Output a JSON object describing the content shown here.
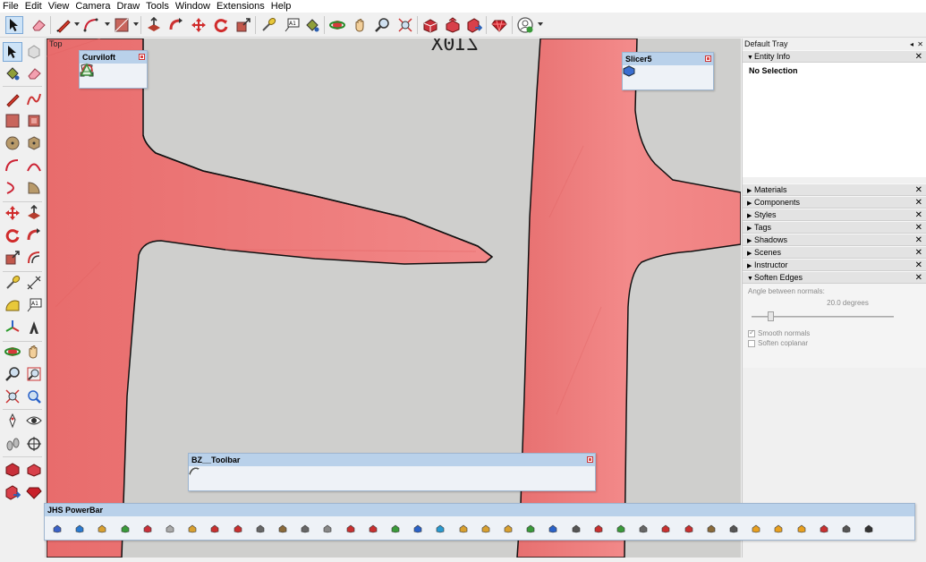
{
  "menu": [
    "File",
    "Edit",
    "View",
    "Camera",
    "Draw",
    "Tools",
    "Window",
    "Extensions",
    "Help"
  ],
  "viewport": {
    "scene_label": "Top",
    "watermark_text": "Z10X"
  },
  "floating_toolbars": {
    "curviloft": {
      "title": "Curviloft"
    },
    "slicer5": {
      "title": "Slicer5"
    },
    "bz_toolbar": {
      "title": "BZ__Toolbar"
    },
    "powerbar": {
      "title": "JHS PowerBar"
    }
  },
  "tray": {
    "title": "Default Tray",
    "entity_info": {
      "title": "Entity Info",
      "body": "No Selection"
    },
    "panels": [
      "Materials",
      "Components",
      "Styles",
      "Tags",
      "Shadows",
      "Scenes",
      "Instructor"
    ],
    "soften_edges": {
      "title": "Soften Edges",
      "angle_label": "Angle between normals:",
      "angle_value": "20.0  degrees",
      "angle_fraction": 0.12,
      "smooth_normals": {
        "label": "Smooth normals",
        "checked": true
      },
      "soften_coplanar": {
        "label": "Soften coplanar",
        "checked": false
      }
    }
  },
  "colors": {
    "model_face": "#f08080",
    "model_face_dark": "#e46e6e",
    "background": "#cfcfcd",
    "edge": "#111111",
    "title_bar": "#b9d1ea",
    "selection": "#cde3f7"
  },
  "icons": {
    "top_toolbar": [
      "select-arrow-icon",
      "eraser-icon",
      "pencil-line-icon",
      "arc-icon",
      "rectangle-icon",
      "push-pull-icon",
      "follow-me-icon",
      "move-icon",
      "rotate-icon",
      "scale-icon",
      "tape-measure-icon",
      "text-icon",
      "paint-bucket-icon",
      "orbit-icon",
      "pan-hand-icon",
      "zoom-icon",
      "zoom-extents-icon",
      "warehouse-icon",
      "extension-warehouse-icon",
      "share-model-icon",
      "ruby-console-icon",
      "profile-icon"
    ],
    "left_toolbar": [
      "select-arrow-icon",
      "lasso-select-icon",
      "paint-bucket-icon",
      "eraser-icon",
      "line-icon",
      "freehand-icon",
      "rectangle-icon",
      "rotated-rectangle-icon",
      "circle-icon",
      "polygon-icon",
      "arc-icon",
      "two-point-arc-icon",
      "three-point-arc-icon",
      "pie-icon",
      "move-icon",
      "push-pull-icon",
      "rotate-icon",
      "follow-me-icon",
      "scale-icon",
      "offset-icon",
      "tape-measure-icon",
      "dimension-icon",
      "protractor-icon",
      "text-icon",
      "axes-icon",
      "3d-text-icon",
      "orbit-icon",
      "pan-hand-icon",
      "zoom-icon",
      "zoom-window-icon",
      "zoom-extents-icon",
      "previous-view-icon",
      "position-camera-icon",
      "look-around-icon",
      "walk-icon",
      "section-plane-icon",
      "warehouse-icon",
      "extension-warehouse-icon",
      "share-model-icon",
      "ruby-icon"
    ],
    "curviloft": [
      "loft-by-spline-icon",
      "skin-contours-icon",
      "loft-along-path-icon"
    ],
    "slicer5": [
      "slice-x-icon",
      "slice-y-icon",
      "slice-z-icon",
      "slice-options-icon"
    ]
  }
}
